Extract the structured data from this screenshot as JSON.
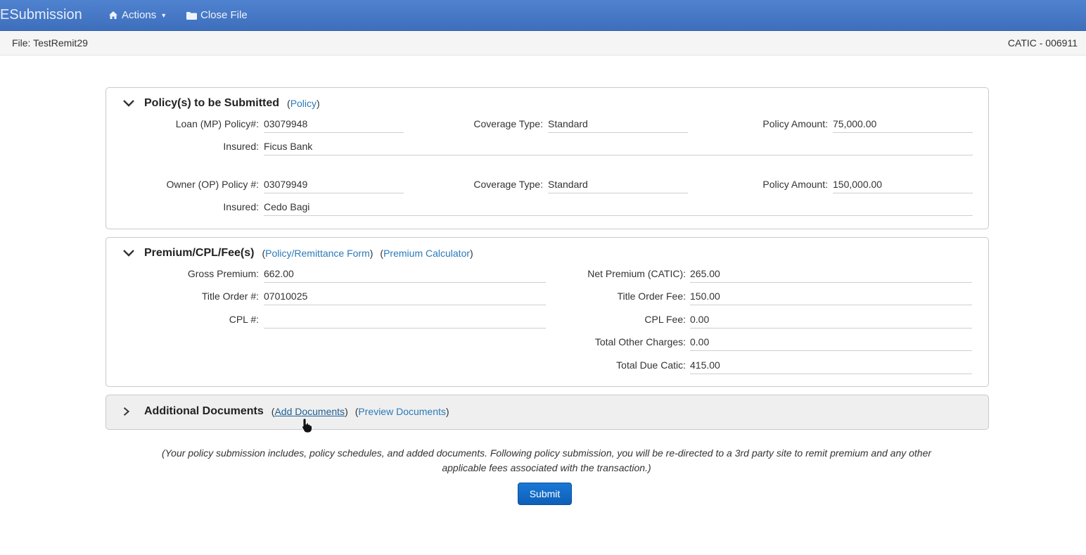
{
  "app": {
    "brand": "ESubmission"
  },
  "nav": {
    "actions_label": "Actions",
    "close_file_label": "Close File"
  },
  "filebar": {
    "file_label": "File: TestRemit29",
    "agent_id": "CATIC - 006911"
  },
  "policies": {
    "title": "Policy(s) to be Submitted",
    "link": "Policy",
    "loan": {
      "policy_label": "Loan (MP) Policy#:",
      "policy_value": "03079948",
      "coverage_label": "Coverage Type:",
      "coverage_value": "Standard",
      "amount_label": "Policy Amount:",
      "amount_value": "75,000.00",
      "insured_label": "Insured:",
      "insured_value": "Ficus Bank"
    },
    "owner": {
      "policy_label": "Owner (OP) Policy #:",
      "policy_value": "03079949",
      "coverage_label": "Coverage Type:",
      "coverage_value": "Standard",
      "amount_label": "Policy Amount:",
      "amount_value": "150,000.00",
      "insured_label": "Insured:",
      "insured_value": "Cedo Bagi"
    }
  },
  "premium": {
    "title": "Premium/CPL/Fee(s)",
    "link1": "Policy/Remittance Form",
    "link2": "Premium Calculator",
    "gross_label": "Gross Premium:",
    "gross_value": "662.00",
    "title_order_label": "Title Order #:",
    "title_order_value": "07010025",
    "cpl_label": "CPL #:",
    "cpl_value": "",
    "net_label": "Net Premium (CATIC):",
    "net_value": "265.00",
    "title_fee_label": "Title Order Fee:",
    "title_fee_value": "150.00",
    "cpl_fee_label": "CPL Fee:",
    "cpl_fee_value": "0.00",
    "other_label": "Total Other Charges:",
    "other_value": "0.00",
    "total_label": "Total Due Catic:",
    "total_value": "415.00"
  },
  "documents": {
    "title": "Additional Documents",
    "add_link": "Add Documents",
    "preview_link": "Preview Documents"
  },
  "note": {
    "line1": "(Your policy submission includes, policy schedules, and added documents. Following policy submission, you will be re-directed to a 3rd party site to remit premium and any other",
    "line2": "applicable fees associated with the transaction.)"
  },
  "submit_label": "Submit",
  "colors": {
    "navbar": "#3e6fbd",
    "link": "#2a7ab8",
    "submit": "#0e5fb8"
  }
}
